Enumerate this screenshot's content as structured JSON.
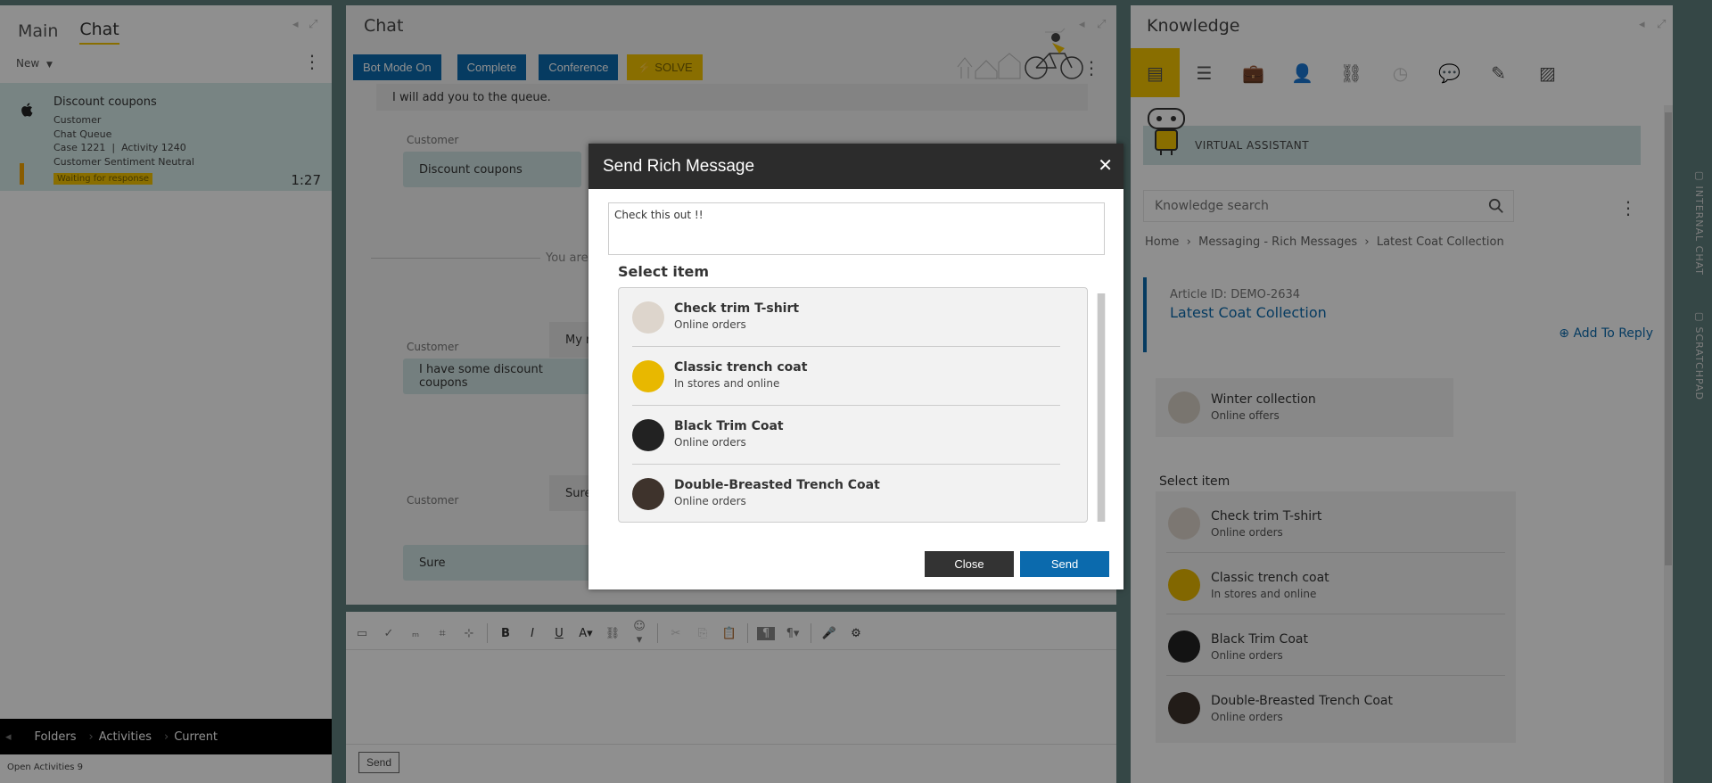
{
  "left": {
    "tabs": [
      "Main",
      "Chat"
    ],
    "new_label": "New",
    "work_item": {
      "title": "Discount coupons",
      "lines": [
        "Customer",
        "Chat Queue",
        "Case 1221  |  Activity 1240",
        "Customer Sentiment Neutral"
      ],
      "badge": "Waiting for response",
      "time": "1:27"
    },
    "bottom_nav": [
      "Folders",
      "Activities",
      "Current"
    ],
    "open_activities": "Open Activities 9"
  },
  "chat": {
    "title": "Chat",
    "buttons": [
      "Bot Mode On",
      "Complete",
      "Conference",
      "SOLVE"
    ],
    "messages": {
      "agent_queue": "I will add you to the queue.",
      "customer_label": "Customer",
      "customer_1": "Discount coupons",
      "system_partial": "You are c",
      "agent_partial_1": "My n",
      "customer_2": "I have some discount coupons",
      "agent_partial_2": "Sure",
      "customer_3": "Sure"
    },
    "send_label": "Send"
  },
  "knowledge": {
    "title": "Knowledge",
    "virtual_assistant": "VIRTUAL ASSISTANT",
    "search_placeholder": "Knowledge search",
    "breadcrumb": [
      "Home",
      "Messaging - Rich Messages",
      "Latest Coat Collection"
    ],
    "article_id": "Article ID: DEMO-2634",
    "article_title": "Latest Coat Collection",
    "add_to_reply": "Add To Reply",
    "card": {
      "name": "Winter collection",
      "sub": "Online offers"
    },
    "select_item": "Select item",
    "items": [
      {
        "name": "Check trim T-shirt",
        "sub": "Online orders"
      },
      {
        "name": "Classic trench coat",
        "sub": "In stores and online"
      },
      {
        "name": "Black Trim Coat",
        "sub": "Online orders"
      },
      {
        "name": "Double-Breasted Trench Coat",
        "sub": "Online orders"
      }
    ],
    "side_tabs": [
      "INTERNAL CHAT",
      "SCRATCHPAD"
    ]
  },
  "modal": {
    "title": "Send Rich Message",
    "message": "Check this out !!",
    "select_item": "Select item",
    "items": [
      {
        "name": "Check trim T-shirt",
        "sub": "Online orders"
      },
      {
        "name": "Classic trench coat",
        "sub": "In stores and online"
      },
      {
        "name": "Black Trim Coat",
        "sub": "Online orders"
      },
      {
        "name": "Double-Breasted Trench Coat",
        "sub": "Online orders"
      }
    ],
    "close_label": "Close",
    "send_label": "Send"
  }
}
